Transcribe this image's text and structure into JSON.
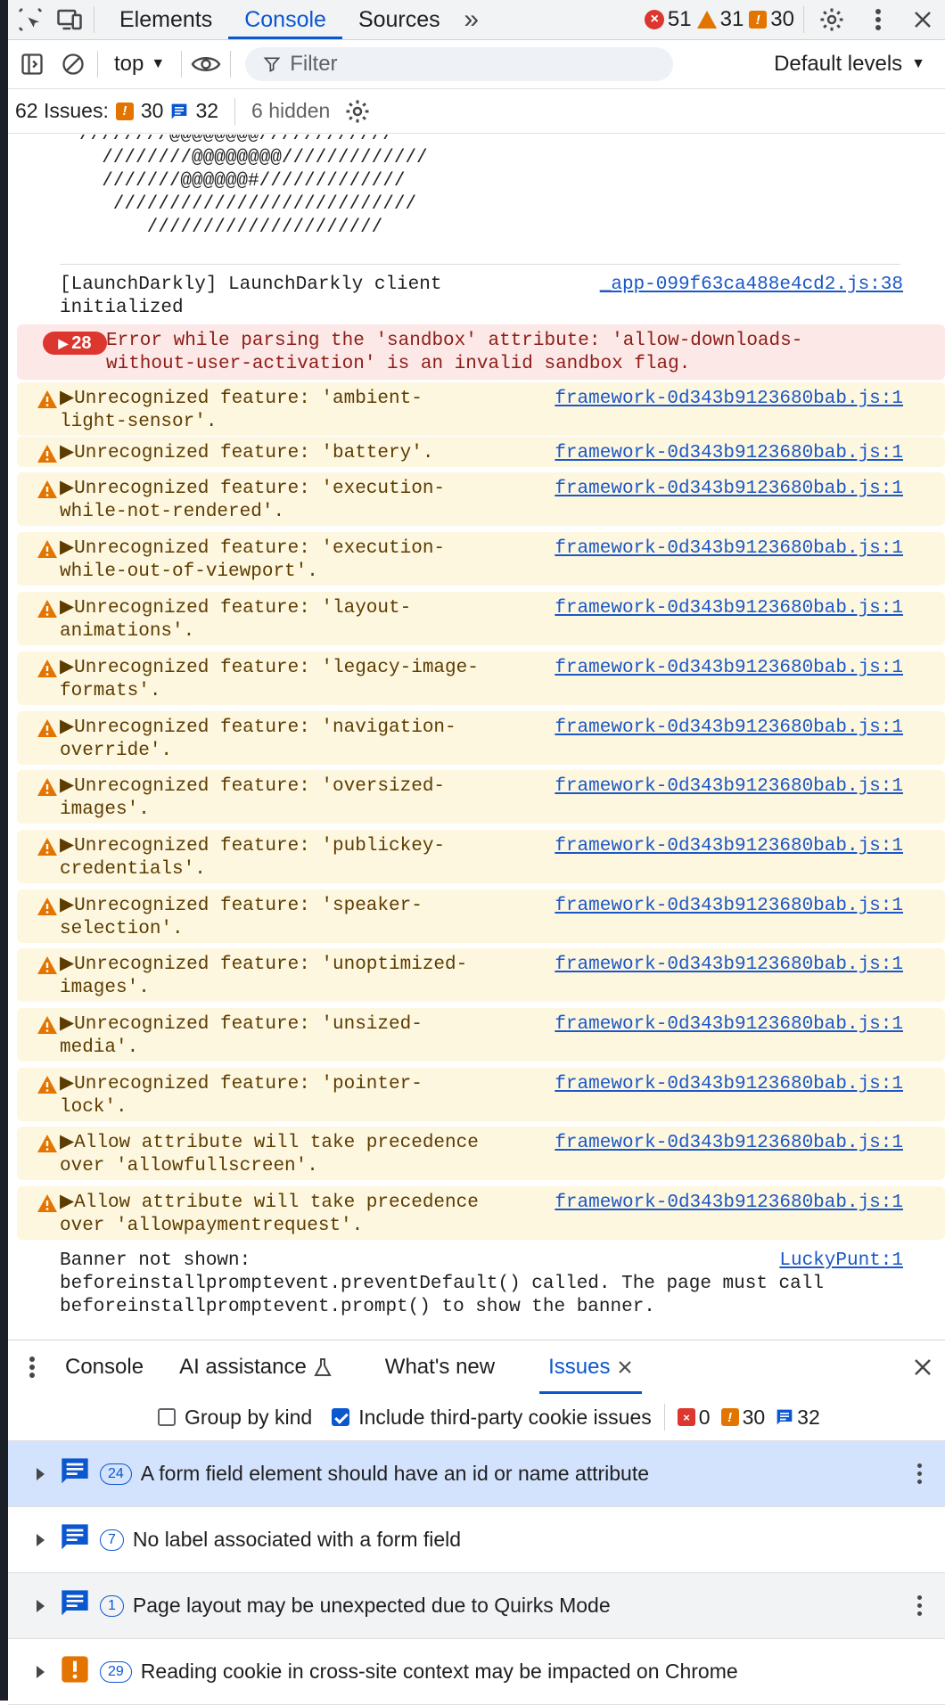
{
  "tabbar": {
    "tabs": [
      "Elements",
      "Console",
      "Sources"
    ],
    "active": "Console",
    "error_count": "51",
    "warning_count": "31",
    "issue_count": "30"
  },
  "toolbar": {
    "context": "top",
    "filter_placeholder": "Filter",
    "levels": "Default levels"
  },
  "issues_bar": {
    "label": "62 Issues:",
    "warn_count": "30",
    "info_count": "32",
    "hidden": "6 hidden"
  },
  "ascii_art": "////////@@@@@@@@////////////\n  ////////@@@@@@@@/////////////\n  ///////@@@@@@#/////////////\n   ///////////////////////////\n      /////////////////////",
  "log": [
    {
      "type": "plain",
      "msg": "[LaunchDarkly] LaunchDarkly client\ninitialized",
      "src": "_app-099f63ca488e4cd2.js:38"
    },
    {
      "type": "err",
      "count": "28",
      "msg": "Error while parsing the 'sandbox' attribute: 'allow-downloads-\nwithout-user-activation' is an invalid sandbox flag.",
      "src": ""
    },
    {
      "type": "warn",
      "msg": "▶Unrecognized feature: 'ambient-\nlight-sensor'.",
      "src": "framework-0d343b9123680bab.js:1"
    },
    {
      "type": "warn",
      "msg": "▶Unrecognized feature: 'battery'.",
      "src": "framework-0d343b9123680bab.js:1"
    },
    {
      "type": "warn",
      "msg": "▶Unrecognized feature: 'execution-\nwhile-not-rendered'.",
      "src": "framework-0d343b9123680bab.js:1"
    },
    {
      "type": "warn",
      "msg": "▶Unrecognized feature: 'execution-\nwhile-out-of-viewport'.",
      "src": "framework-0d343b9123680bab.js:1"
    },
    {
      "type": "warn",
      "msg": "▶Unrecognized feature: 'layout-\nanimations'.",
      "src": "framework-0d343b9123680bab.js:1"
    },
    {
      "type": "warn",
      "msg": "▶Unrecognized feature: 'legacy-image-\nformats'.",
      "src": "framework-0d343b9123680bab.js:1"
    },
    {
      "type": "warn",
      "msg": "▶Unrecognized feature: 'navigation-\noverride'.",
      "src": "framework-0d343b9123680bab.js:1"
    },
    {
      "type": "warn",
      "msg": "▶Unrecognized feature: 'oversized-\nimages'.",
      "src": "framework-0d343b9123680bab.js:1"
    },
    {
      "type": "warn",
      "msg": "▶Unrecognized feature: 'publickey-\ncredentials'.",
      "src": "framework-0d343b9123680bab.js:1"
    },
    {
      "type": "warn",
      "msg": "▶Unrecognized feature: 'speaker-\nselection'.",
      "src": "framework-0d343b9123680bab.js:1"
    },
    {
      "type": "warn",
      "msg": "▶Unrecognized feature: 'unoptimized-\nimages'.",
      "src": "framework-0d343b9123680bab.js:1"
    },
    {
      "type": "warn",
      "msg": "▶Unrecognized feature: 'unsized-\nmedia'.",
      "src": "framework-0d343b9123680bab.js:1"
    },
    {
      "type": "warn",
      "msg": "▶Unrecognized feature: 'pointer-\nlock'.",
      "src": "framework-0d343b9123680bab.js:1"
    },
    {
      "type": "warn",
      "msg": "▶Allow attribute will take precedence\nover 'allowfullscreen'.",
      "src": "framework-0d343b9123680bab.js:1"
    },
    {
      "type": "warn",
      "msg": "▶Allow attribute will take precedence\nover 'allowpaymentrequest'.",
      "src": "framework-0d343b9123680bab.js:1"
    },
    {
      "type": "plain",
      "msg": "Banner not shown:\nbeforeinstallpromptevent.preventDefault() called. The page must call\nbeforeinstallpromptevent.prompt() to show the banner.",
      "src": "LuckyPunt:1"
    }
  ],
  "drawer": {
    "tabs": [
      "Console",
      "AI assistance",
      "What's new",
      "Issues"
    ],
    "active": "Issues"
  },
  "issues_toolbar": {
    "group_by_kind": "Group by kind",
    "include_third_party": "Include third-party cookie issues",
    "err": "0",
    "warn": "30",
    "info": "32"
  },
  "issues": [
    {
      "kind": "info",
      "count": "24",
      "text": "A form field element should have an id or name attribute"
    },
    {
      "kind": "info",
      "count": "7",
      "text": "No label associated with a form field"
    },
    {
      "kind": "info",
      "count": "1",
      "text": "Page layout may be unexpected due to Quirks Mode"
    },
    {
      "kind": "warn",
      "count": "29",
      "text": "Reading cookie in cross-site context may be impacted on Chrome"
    }
  ],
  "colors": {
    "accent": "#0b57d0",
    "error": "#dc362e",
    "warning": "#e37400",
    "warn_bg": "#fef7e0",
    "err_bg": "#fce8e6",
    "selected": "#d3e3fd"
  }
}
